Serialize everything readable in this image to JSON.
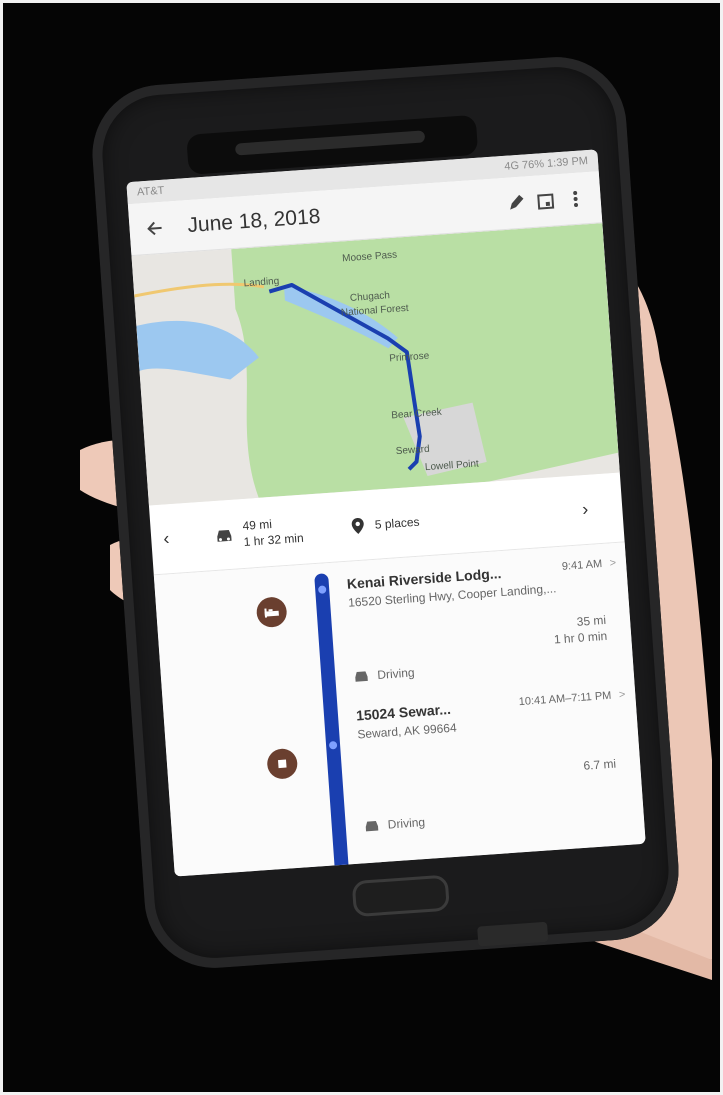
{
  "status": {
    "carrier": "AT&T",
    "right": "4G 76% 1:39 PM"
  },
  "header": {
    "title": "June 18, 2018"
  },
  "icons": {
    "back": "back-arrow-icon",
    "edit": "pencil-icon",
    "calendar": "calendar-icon",
    "more": "more-vert-icon"
  },
  "map": {
    "labels": [
      "Moose Pass",
      "Landing",
      "Chugach",
      "National Forest",
      "Primrose",
      "Bear Creek",
      "Seward",
      "Lowell Point"
    ]
  },
  "summary": {
    "distance": "49 mi",
    "duration": "1 hr 32 min",
    "places": "5 places"
  },
  "timeline": {
    "stops": [
      {
        "name": "Kenai Riverside Lodg...",
        "address": "16520 Sterling Hwy, Cooper Landing,...",
        "time": "9:41 AM"
      },
      {
        "name": "15024 Sewar...",
        "address": "Seward, AK 99664",
        "time": "10:41 AM–7:11 PM"
      }
    ],
    "legs": [
      {
        "mode": "Driving",
        "distance": "35 mi",
        "duration": "1 hr 0 min"
      },
      {
        "mode": "Driving",
        "distance": "6.7 mi",
        "duration": ""
      }
    ]
  },
  "colors": {
    "route": "#1a3fb0",
    "stop_icon": "#6a3f2f",
    "forest": "#b9dfa4",
    "water": "#9cc8f0"
  }
}
